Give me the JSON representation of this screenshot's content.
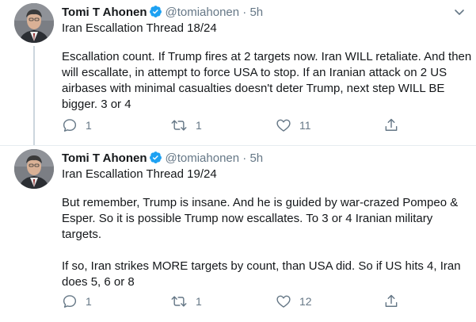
{
  "tweets": [
    {
      "author_name": "Tomi T Ahonen",
      "handle": "@tomiahonen",
      "separator": "·",
      "time": "5h",
      "thread_title": "Iran Escallation Thread 18/24",
      "paragraphs": [
        "Escallation count. If Trump fires at 2 targets now. Iran WILL retaliate. And then will escallate, in attempt to force USA to stop. If an Iranian attack on 2 US airbases with minimal casualties doesn't deter Trump, next step WILL BE bigger. 3 or 4"
      ],
      "reply_count": "1",
      "retweet_count": "1",
      "like_count": "11"
    },
    {
      "author_name": "Tomi T Ahonen",
      "handle": "@tomiahonen",
      "separator": "·",
      "time": "5h",
      "thread_title": "Iran Escallation Thread 19/24",
      "paragraphs": [
        "But remember, Trump is insane. And he is guided by war-crazed Pompeo & Esper. So it is possible Trump now escallates. To 3 or 4 Iranian military targets.",
        "If so, Iran strikes MORE targets by count, than USA did. So if US hits 4, Iran does 5, 6 or 8"
      ],
      "reply_count": "1",
      "retweet_count": "1",
      "like_count": "12"
    }
  ],
  "icons": {
    "verified": "verified-badge-icon",
    "more": "chevron-down-icon",
    "reply": "reply-icon",
    "retweet": "retweet-icon",
    "like": "heart-icon",
    "share": "share-icon"
  },
  "colors": {
    "text": "#14171a",
    "secondary": "#657786",
    "verified": "#1da1f2",
    "divider": "#e6ecf0"
  }
}
